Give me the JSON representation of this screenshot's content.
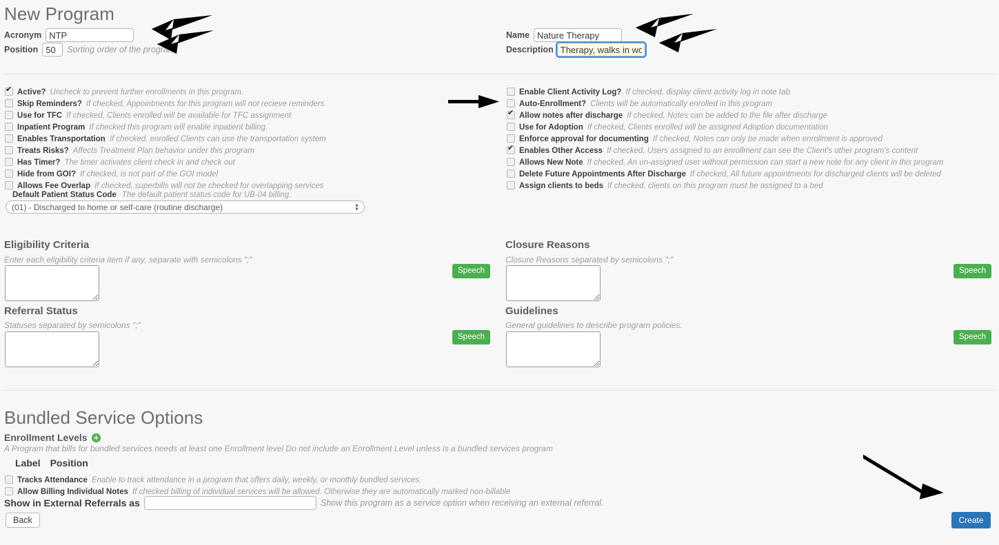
{
  "page": {
    "title": "New Program",
    "bundled_title": "Bundled Service Options"
  },
  "top_left": {
    "acronym_label": "Acronym",
    "acronym_value": "NTP",
    "position_label": "Position",
    "position_value": "50",
    "position_hint": "Sorting order of the program"
  },
  "top_right": {
    "name_label": "Name",
    "name_value": "Nature Therapy",
    "description_label": "Description",
    "description_value": "Therapy, walks in woods"
  },
  "checkboxes_left": [
    {
      "label": "Active?",
      "hint": "Uncheck to prevent further enrollments in this program.",
      "checked": true
    },
    {
      "label": "Skip Reminders?",
      "hint": "If checked, Appointments for this program will not recieve reminders",
      "checked": false
    },
    {
      "label": "Use for TFC",
      "hint": "If checked, Clients enrolled will be available for TFC assignment",
      "checked": false
    },
    {
      "label": "Inpatient Program",
      "hint": "If checked this program will enable inpatient billing.",
      "checked": false
    },
    {
      "label": "Enables Transportation",
      "hint": "If checked, enrolled Clients can use the transportation system",
      "checked": false
    },
    {
      "label": "Treats Risks?",
      "hint": "Affects Treatment Plan behavior under this program",
      "checked": false
    },
    {
      "label": "Has Timer?",
      "hint": "The timer activates client check in and check out",
      "checked": false
    },
    {
      "label": "Hide from GOI?",
      "hint": "If checked, is not part of the GOI model",
      "checked": false
    },
    {
      "label": "Allows Fee Overlap",
      "hint": "If checked, superbills will not be checked for overlapping services",
      "checked": false
    }
  ],
  "status_code": {
    "label": "Default Patient Status Code",
    "hint": "The default patient status code for UB-04 billing.",
    "selected": "(01) - Discharged to home or self-care (routine discharge)"
  },
  "checkboxes_right": [
    {
      "label": "Enable Client Activity Log?",
      "hint": "If checked, display client activity log in note tab",
      "checked": false
    },
    {
      "label": "Auto-Enrollment?",
      "hint": "Clients will be automatically enrolled in this program",
      "checked": false
    },
    {
      "label": "Allow notes after discharge",
      "hint": "If checked, Notes can be added to the file after discharge",
      "checked": true
    },
    {
      "label": "Use for Adoption",
      "hint": "If checked, Clients enrolled will be assigned Adoption documentation",
      "checked": false
    },
    {
      "label": "Enforce approval for documenting",
      "hint": "If checked, Notes can only be made when enrollment is approved",
      "checked": false
    },
    {
      "label": "Enables Other Access",
      "hint": "If checked, Users assigned to an enrollment can see the Client's other program's content",
      "checked": true
    },
    {
      "label": "Allows New Note",
      "hint": "If checked, An un-assigned user without permission can start a new note for any client in this program",
      "checked": false
    },
    {
      "label": "Delete Future Appointments After Discharge",
      "hint": "If checked, All future appointments for discharged clients will be deleted",
      "checked": false
    },
    {
      "label": "Assign clients to beds",
      "hint": "If checked, clients on this program must be assigned to a bed",
      "checked": false
    }
  ],
  "eligibility": {
    "heading": "Eligibility Criteria",
    "hint": "Enter each eligibility criteria item if any, separate with semicolons \";\"",
    "value": "",
    "speech_label": "Speech"
  },
  "referral": {
    "heading": "Referral Status",
    "hint": "Statuses separated by semicolons \";\"",
    "value": "",
    "speech_label": "Speech"
  },
  "closure": {
    "heading": "Closure Reasons",
    "hint": "Closure Reasons separated by semicolons \";\"",
    "value": "",
    "speech_label": "Speech"
  },
  "guidelines": {
    "heading": "Guidelines",
    "hint": "General guidelines to describe program policies.",
    "value": "",
    "speech_label": "Speech"
  },
  "bundled": {
    "enrollment_levels_label": "Enrollment Levels",
    "enrollment_hint": "A Program that bills for bundled services needs at least one Enrollment level Do not include an Enrollment Level unless is a bundled services program",
    "col_label": "Label",
    "col_position": "Position",
    "checkboxes": [
      {
        "label": "Tracks Attendance",
        "hint": "Enable to track attendance in a program that offers daily, weekly, or monthly bundled services.",
        "checked": false
      },
      {
        "label": "Allow Billing Individual Notes",
        "hint": "If checked billing of individual services will be allowed. Otherwise they are automatically marked non-billable",
        "checked": false
      }
    ],
    "external_referral_label": "Show in External Referrals as",
    "external_referral_value": "",
    "external_referral_hint": "Show this program as a service option when receiving an external referral."
  },
  "actions": {
    "back_label": "Back",
    "create_label": "Create"
  },
  "colors": {
    "speech_green": "#4aaf50",
    "create_blue": "#2a74b8",
    "add_green": "#5cb85c",
    "focus_blue": "#4a90e2",
    "autofill_yellow": "#fdfbe2"
  }
}
